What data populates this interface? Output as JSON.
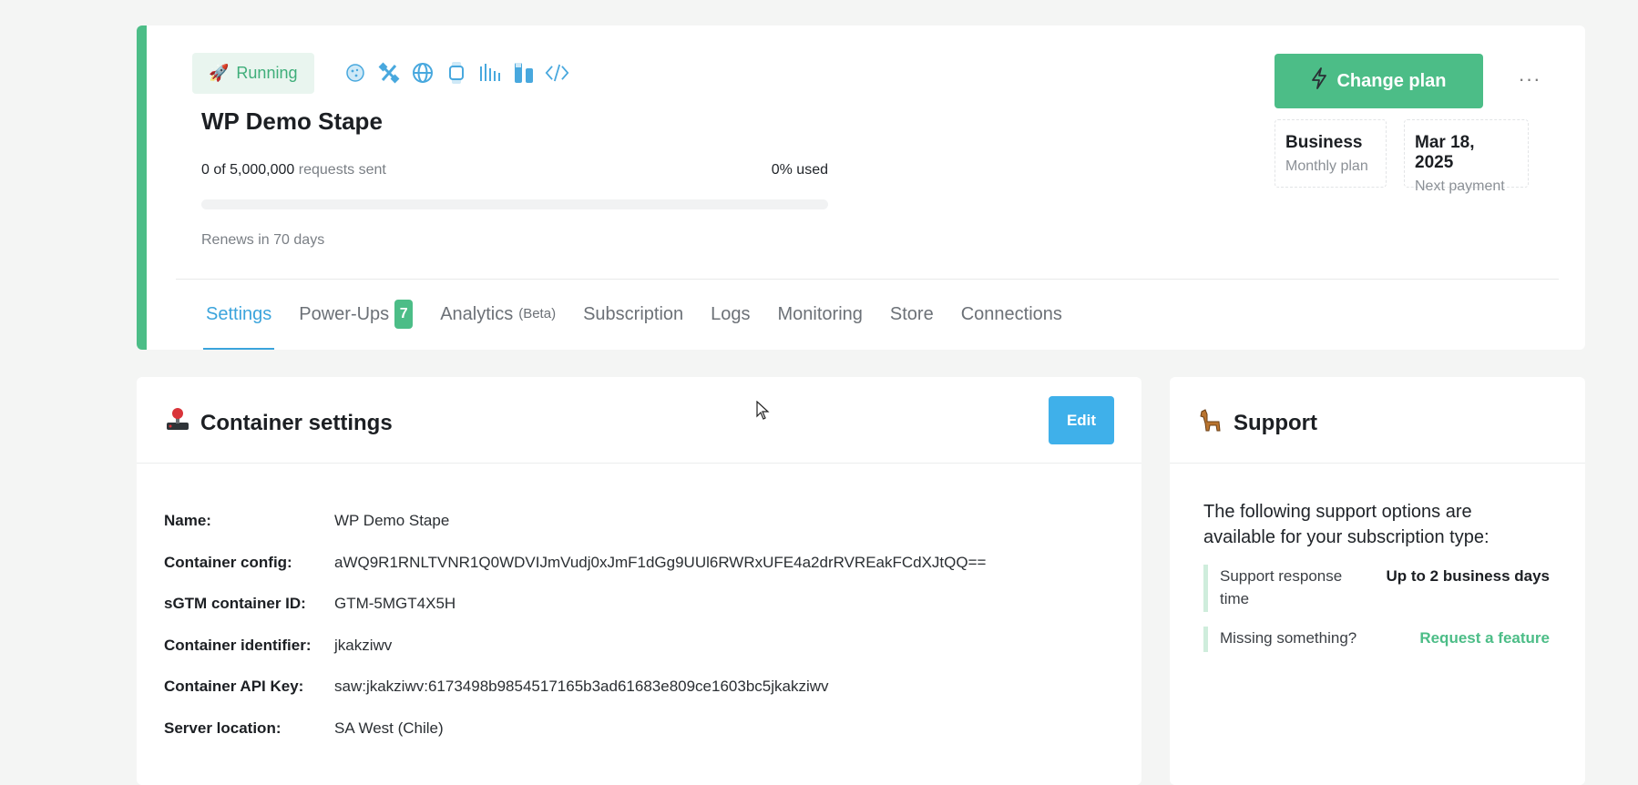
{
  "header": {
    "status": "Running",
    "title": "WP Demo Stape",
    "usage": {
      "count": "0 of 5,000,000",
      "suffix": "requests sent",
      "percent_label": "0% used",
      "percent": 0
    },
    "renews": "Renews in 70 days",
    "change_plan_label": "Change plan",
    "more_label": "···",
    "plan": {
      "name": "Business",
      "caption": "Monthly plan"
    },
    "payment": {
      "date": "Mar 18, 2025",
      "caption": "Next payment"
    },
    "powerup_icons": [
      "cookie-icon",
      "satellite-icon",
      "globe-icon",
      "watch-icon",
      "signal-bars-icon",
      "flask-icon",
      "code-icon"
    ]
  },
  "tabs": [
    {
      "label": "Settings",
      "active": true
    },
    {
      "label": "Power-Ups",
      "badge": "7"
    },
    {
      "label": "Analytics",
      "suffix": "(Beta)"
    },
    {
      "label": "Subscription"
    },
    {
      "label": "Logs"
    },
    {
      "label": "Monitoring"
    },
    {
      "label": "Store"
    },
    {
      "label": "Connections"
    }
  ],
  "settings": {
    "title": "Container settings",
    "edit_label": "Edit",
    "fields": [
      {
        "label": "Name:",
        "value": "WP Demo Stape"
      },
      {
        "label": "Container config:",
        "value": "aWQ9R1RNLTVNR1Q0WDVIJmVudj0xJmF1dGg9UUl6RWRxUFE4a2drRVREakFCdXJtQQ=="
      },
      {
        "label": "sGTM container ID:",
        "value": "GTM-5MGT4X5H"
      },
      {
        "label": "Container identifier:",
        "value": "jkakziwv"
      },
      {
        "label": "Container API Key:",
        "value": "saw:jkakziwv:6173498b9854517165b3ad61683e809ce1603bc5jkakziwv"
      },
      {
        "label": "Server location:",
        "value": "SA West (Chile)"
      }
    ]
  },
  "support": {
    "title": "Support",
    "intro": "The following support options are available for your subscription type:",
    "response_label": "Support response time",
    "response_value": "Up to 2 business days",
    "missing_label": "Missing something?",
    "request_link": "Request a feature"
  },
  "colors": {
    "accent_green": "#4cbd87",
    "accent_blue": "#3fb0ea"
  }
}
